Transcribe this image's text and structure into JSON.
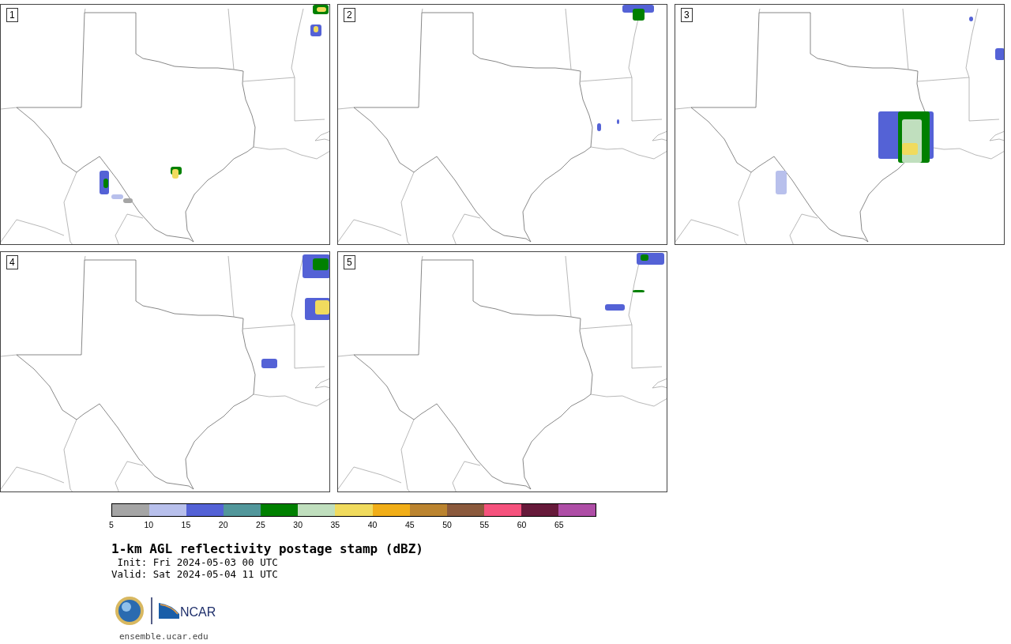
{
  "panels": [
    {
      "label": "1"
    },
    {
      "label": "2"
    },
    {
      "label": "3"
    },
    {
      "label": "4"
    },
    {
      "label": "5"
    }
  ],
  "colorbar": {
    "bins": [
      {
        "label": "5",
        "color": "#a5a5a5"
      },
      {
        "label": "10",
        "color": "#b8c0ec"
      },
      {
        "label": "15",
        "color": "#5462d6"
      },
      {
        "label": "20",
        "color": "#52979b"
      },
      {
        "label": "25",
        "color": "#008000"
      },
      {
        "label": "30",
        "color": "#c0dfbe"
      },
      {
        "label": "35",
        "color": "#f0db5e"
      },
      {
        "label": "40",
        "color": "#f1ae18"
      },
      {
        "label": "45",
        "color": "#bb8430"
      },
      {
        "label": "50",
        "color": "#8b5a3d"
      },
      {
        "label": "55",
        "color": "#f5527d"
      },
      {
        "label": "60",
        "color": "#661a3a"
      },
      {
        "label": "65",
        "color": "#ae4ea6"
      }
    ]
  },
  "title": "1-km AGL reflectivity postage stamp (dBZ)",
  "init": " Init: Fri 2024-05-03 00 UTC",
  "valid": "Valid: Sat 2024-05-04 11 UTC",
  "logo_text": "NCAR",
  "footer_url": "ensemble.ucar.edu"
}
